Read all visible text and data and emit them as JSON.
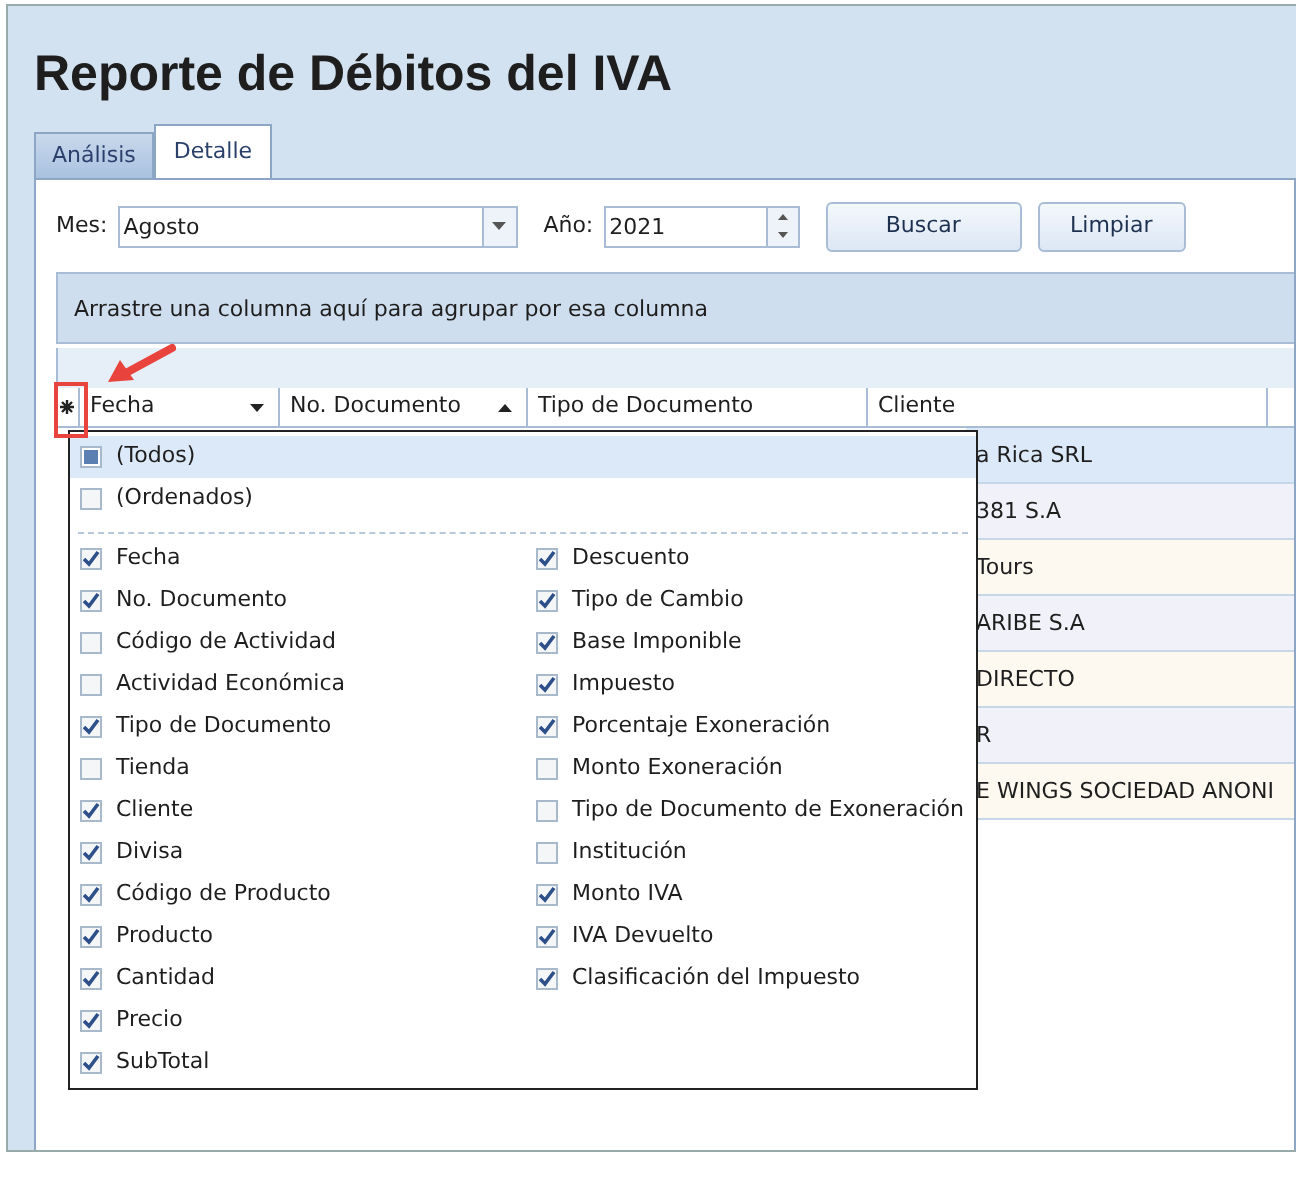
{
  "title": "Reporte de Débitos del IVA",
  "tabs": [
    {
      "label": "Análisis",
      "selected": false
    },
    {
      "label": "Detalle",
      "selected": true
    }
  ],
  "filters": {
    "month_label": "Mes:",
    "month": "Agosto",
    "year_label": "Año:",
    "year": "2021"
  },
  "buttons": [
    "Buscar",
    "Limpiar"
  ],
  "group_panel": "Arrastre una columna aquí para agrupar por esa columna",
  "grid": {
    "columns": [
      {
        "label": "Fecha",
        "filter_dropdown": true,
        "sorted_ascending": false
      },
      {
        "label": "No. Documento",
        "filter_dropdown": false,
        "sorted_ascending": true
      },
      {
        "label": "Tipo de Documento",
        "filter_dropdown": false,
        "sorted_ascending": false
      },
      {
        "label": "Cliente",
        "filter_dropdown": false,
        "sorted_ascending": false
      }
    ],
    "rows": [
      {
        "cliente": "a Rica SRL",
        "selected": true
      },
      {
        "cliente": "381 S.A",
        "selected": false
      },
      {
        "cliente": "Tours",
        "selected": false
      },
      {
        "cliente": "ARIBE S.A",
        "selected": false
      },
      {
        "cliente": "DIRECTO",
        "selected": false
      },
      {
        "cliente": "R",
        "selected": false
      },
      {
        "cliente": "E WINGS SOCIEDAD ANONI",
        "selected": false
      }
    ]
  },
  "column_chooser": {
    "special": [
      {
        "label": "(Todos)",
        "indeterminate": true,
        "selected": true
      },
      {
        "label": "(Ordenados)",
        "indeterminate": false,
        "selected": false
      }
    ],
    "items": [
      {
        "label": "Fecha",
        "checked": true
      },
      {
        "label": "No. Documento",
        "checked": true
      },
      {
        "label": "Código de Actividad",
        "checked": false
      },
      {
        "label": "Actividad Económica",
        "checked": false
      },
      {
        "label": "Tipo de Documento",
        "checked": true
      },
      {
        "label": "Tienda",
        "checked": false
      },
      {
        "label": "Cliente",
        "checked": true
      },
      {
        "label": "Divisa",
        "checked": true
      },
      {
        "label": "Código de Producto",
        "checked": true
      },
      {
        "label": "Producto",
        "checked": true
      },
      {
        "label": "Cantidad",
        "checked": true
      },
      {
        "label": "Precio",
        "checked": true
      },
      {
        "label": "SubTotal",
        "checked": true
      },
      {
        "label": "Descuento",
        "checked": true
      },
      {
        "label": "Tipo de Cambio",
        "checked": true
      },
      {
        "label": "Base Imponible",
        "checked": true
      },
      {
        "label": "Impuesto",
        "checked": true
      },
      {
        "label": "Porcentaje Exoneración",
        "checked": true
      },
      {
        "label": "Monto Exoneración",
        "checked": false
      },
      {
        "label": "Tipo de Documento de Exoneración",
        "checked": false
      },
      {
        "label": "Institución",
        "checked": false
      },
      {
        "label": "Monto IVA",
        "checked": true
      },
      {
        "label": "IVA Devuelto",
        "checked": true
      },
      {
        "label": "Clasificación del Impuesto",
        "checked": true
      }
    ]
  }
}
